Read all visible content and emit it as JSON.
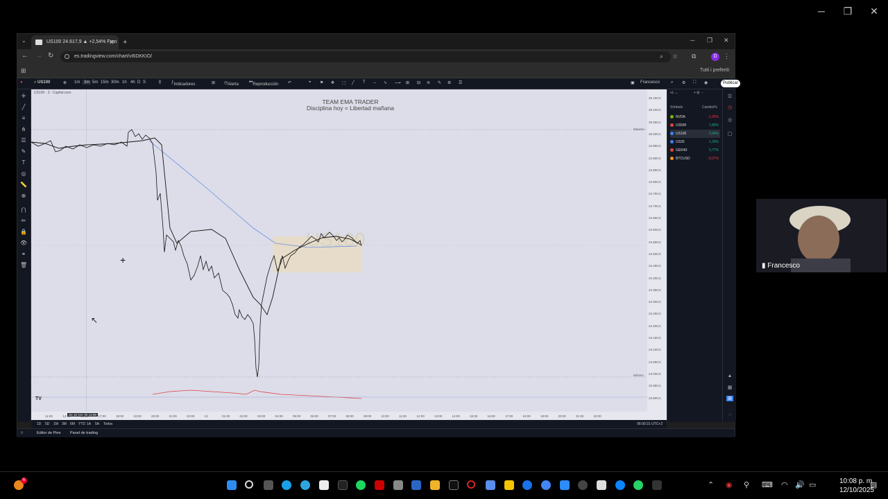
{
  "browser": {
    "tab_title": "US100 24.617,9 ▲ +2,54% Fran",
    "url": "es.tradingview.com/chart/vI6DKKIO/",
    "bookmarks_all": "Tutti i preferiti",
    "profile_initial": "D"
  },
  "toolbar": {
    "symbol": "US100",
    "intervals": [
      "1m",
      "3m",
      "5m",
      "15m",
      "30m",
      "1h",
      "4h",
      "D",
      "S"
    ],
    "indicators_label": "Indicadores",
    "alert_label": "Alerta",
    "replay_label": "Reproducción",
    "user_label": "Francesco",
    "publish_label": "Publicar"
  },
  "chart": {
    "symbol_title": "US100 · 3 · Capital.com",
    "watermark_line1": "TEAM EMA TRADER",
    "watermark_line2": "Disciplina hoy = Libertad mañana",
    "big_watermark": "US100",
    "max_label": "Máximo",
    "min_label": "Mínimo",
    "price_ticks": [
      "25.150,0",
      "25.100,0",
      "25.050,0",
      "25.000,0",
      "24.950,0",
      "24.900,0",
      "24.850,0",
      "24.800,0",
      "24.750,0",
      "24.700,0",
      "24.650,0",
      "24.600,0",
      "24.550,0",
      "24.500,0",
      "24.450,0",
      "24.400,0",
      "24.350,0",
      "24.300,0",
      "24.250,0",
      "24.200,0",
      "24.150,0",
      "24.100,0",
      "24.050,0",
      "24.000,0",
      "23.950,0",
      "23.900,0"
    ],
    "time_ticks": [
      "11:00",
      "14:00",
      "15:00",
      "17:00",
      "18:00",
      "19:00",
      "20:00",
      "21:00",
      "22:00",
      "13",
      "01:00",
      "02:00",
      "03:00",
      "04:00",
      "05:00",
      "06:00",
      "07:00",
      "08:00",
      "09:00",
      "10:00",
      "11:00",
      "12:00",
      "13:00",
      "14:00",
      "15:00",
      "16:00",
      "17:00",
      "18:00",
      "19:00",
      "20:00",
      "21:00",
      "22:00"
    ],
    "crosshair_date": "vie 10 Oct '25  13:09",
    "timezone": "06:00:31 UTC+2"
  },
  "watchlist": {
    "header_symbol": "Símbolo",
    "header_change": "Cambio%",
    "items": [
      {
        "name": "NVDA",
        "change": "-1,25%",
        "color": "#76b900"
      },
      {
        "name": "US500",
        "change": "1,89%",
        "color": "#e0463b"
      },
      {
        "name": "US100",
        "change": "2,54%",
        "color": "#3b82f6"
      },
      {
        "name": "US30",
        "change": "1,29%",
        "color": "#3b82f6"
      },
      {
        "name": "GER40",
        "change": "0,77%",
        "color": "#e0463b"
      },
      {
        "name": "BTCUSD",
        "change": "-0,07%",
        "color": "#f7931a"
      }
    ]
  },
  "rangebar": [
    "1D",
    "5D",
    "1M",
    "3M",
    "6M",
    "YTD",
    "1A",
    "5A",
    "Todos"
  ],
  "bottombar": {
    "pine": "Editor de Pine",
    "trading": "Panel de trading"
  },
  "camera": {
    "name": "Francesco"
  },
  "taskbar": {
    "time": "10:08 p. m.",
    "date": "12/10/2025",
    "badge": "6"
  }
}
